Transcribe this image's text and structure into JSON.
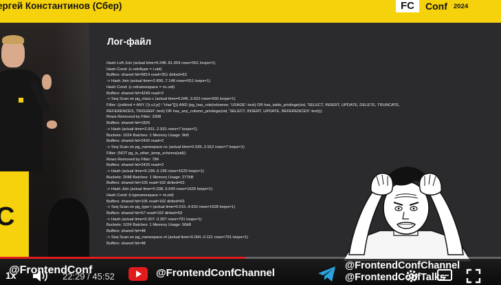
{
  "banner": {
    "speaker_name": "ергей Константинов (Сбер)",
    "logo_mark": "FC",
    "logo_text": "Conf",
    "logo_year": "2024",
    "accent_color": "#f6d20c"
  },
  "stage": {
    "lectern_letter": "C"
  },
  "slide": {
    "title": "Лог-файл",
    "log_lines": [
      "Hash Left Join (actual time=9.248..81.659 rows=551 loops=1)",
      "  Hash Cond: (c.reloftype = t.oid)",
      "  Buffers: shared hit=5814 read=251 dirtied=63",
      "  ->  Hash Join (actual time=2.890..7.148 rows=551 loops=1)",
      "        Hash Cond: (c.relnamespace = nc.oid)",
      "        Buffers: shared hit=4249 read=2",
      "        ->  Seq Scan on pg_class c (actual time=0.046..3.922 rows=555 loops=1)",
      "              Filter: ((relkind = ANY ('{r,v,f,p}'::\"char\"[])) AND (pg_has_role(relowner, 'USAGE'::text) OR has_table_privilege(oid, 'SELECT, INSERT, UPDATE, DELETE, TRUNCATE,",
      "REFERENCES, TRIGGER'::text) OR has_any_column_privilege(oid, 'SELECT, INSERT, UPDATE, REFERENCES'::text)))",
      "              Rows Removed by Filter: 3308",
      "              Buffers: shared hit=1825",
      "        ->  Hash (actual time=2.931..2.931 rows=7 loops=1)",
      "              Buckets: 1024  Batches: 1  Memory Usage: 9kB",
      "              Buffers: shared hit=2420 read=2",
      "              ->  Seq Scan on pg_namespace nc (actual time=0.035..2.912 rows=7 loops=1)",
      "                    Filter: (NOT pg_is_other_temp_schema(oid))",
      "                    Rows Removed by Filter: 784",
      "                    Buffers: shared hit=2420 read=2",
      "  ->  Hash (actual time=6.199..6.199 rows=1629 loops=1)",
      "        Buckets: 2048  Batches: 1  Memory Usage: 277kB",
      "        Buffers: shared hit=105 read=162 dirtied=63",
      "        ->  Hash Join (actual time=0.338..5.640 rows=1629 loops=1)",
      "              Hash Cond: (t.typnamespace = nt.oid)",
      "              Buffers: shared hit=105 read=162 dirtied=63",
      "              ->  Seq Scan on pg_type t (actual time=0.015..4.910 rows=1628 loops=1)",
      "                    Buffers: shared hit=57 read=162 dirtied=63",
      "              ->  Hash (actual time=0.307..0.307 rows=791 loops=1)",
      "                    Buckets: 1024  Batches: 1  Memory Usage: 56kB",
      "                    Buffers: shared hit=48",
      "                    ->  Seq Scan on pg_namespace nt (actual time=0.004..0.121 rows=791 loops=1)",
      "                          Buffers: shared hit=48"
    ]
  },
  "player": {
    "speed": "1x",
    "time_display": "22:29 / 45:52",
    "progress_fraction": 0.49,
    "progress_color": "#e21c1c",
    "handle_left": "@FrontendConf",
    "handle_youtube": "@FrontendConfChannel",
    "handle_telegram_1": "@FrontendConfChannel",
    "handle_telegram_2": "@FrontendConfTalks",
    "icons": [
      "volume-icon",
      "youtube-icon",
      "telegram-icon",
      "settings-icon",
      "subtitles-icon",
      "fullscreen-icon"
    ]
  }
}
